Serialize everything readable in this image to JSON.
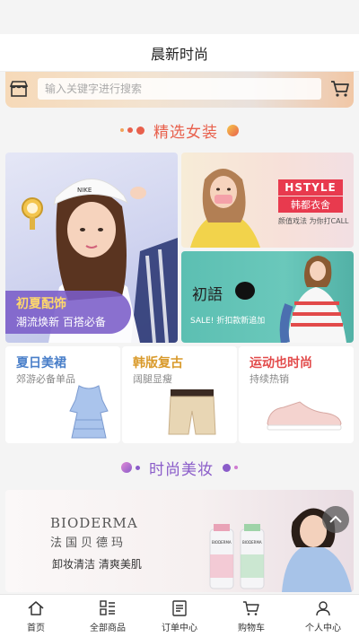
{
  "header": {
    "title": "晨新时尚"
  },
  "search": {
    "placeholder": "输入关键字进行搜索"
  },
  "icons": {
    "shop": "shop-icon",
    "cart": "cart-icon",
    "scroll_top": "chevron-up-icon"
  },
  "colors": {
    "section_fashion": "#e8604c",
    "section_beauty": "#8a5cc9",
    "accent_red": "#e83a4e"
  },
  "sections": {
    "women": {
      "title": "精选女装"
    },
    "beauty": {
      "title": "时尚美妆"
    }
  },
  "women_grid": {
    "big": {
      "tag_title": "初夏配饰",
      "tag_sub": "潮流焕新 百搭必备",
      "cap_text": "NIKE"
    },
    "top_right": {
      "brand": "HSTYLE",
      "sub": "韩都衣舍",
      "slogan": "颜值戏法 为你打CALL"
    },
    "bottom_right": {
      "name": "初語",
      "sale": "SALE! 折扣款新追加"
    }
  },
  "category_cards": [
    {
      "title": "夏日美裙",
      "sub": "郊游必备单品"
    },
    {
      "title": "韩版复古",
      "sub": "阔腿显瘦"
    },
    {
      "title": "运动也时尚",
      "sub": "持续热销"
    }
  ],
  "beauty_banner": {
    "brand": "BIODERMA",
    "brand_cn": "法国贝德玛",
    "slogan": "卸妆清洁 清爽美肌",
    "bottle_label": "BIODERMA"
  },
  "bottom_nav": [
    {
      "label": "首页",
      "icon": "home-icon"
    },
    {
      "label": "全部商品",
      "icon": "grid-list-icon"
    },
    {
      "label": "订单中心",
      "icon": "order-icon"
    },
    {
      "label": "购物车",
      "icon": "cart-icon"
    },
    {
      "label": "个人中心",
      "icon": "user-icon"
    }
  ]
}
